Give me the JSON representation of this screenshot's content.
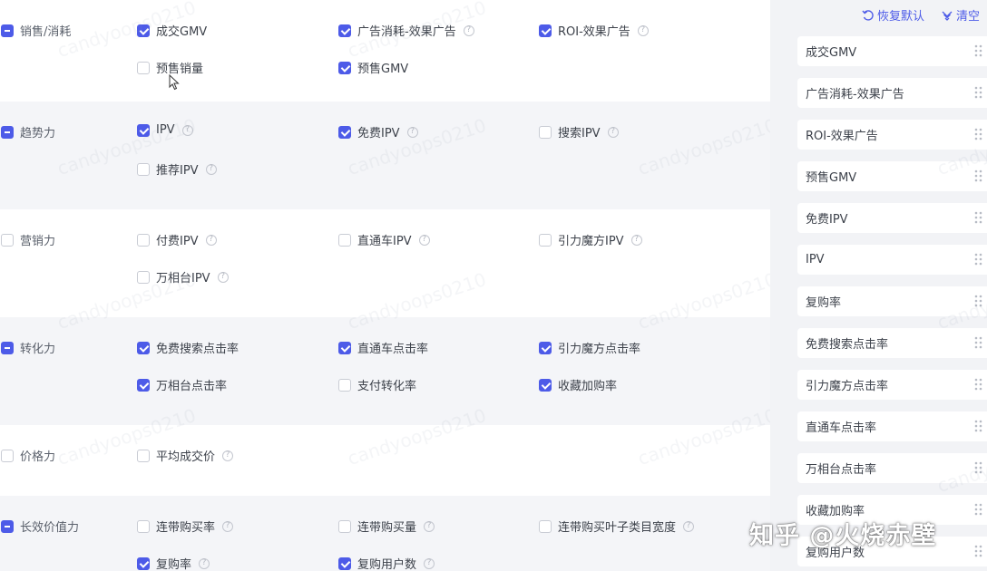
{
  "groups": [
    {
      "label": "销售/消耗",
      "state": "mixed",
      "items": [
        {
          "label": "成交GMV",
          "checked": true,
          "help": false
        },
        {
          "label": "广告消耗-效果广告",
          "checked": true,
          "help": true
        },
        {
          "label": "ROI-效果广告",
          "checked": true,
          "help": true
        },
        {
          "label": "预售销量",
          "checked": false,
          "help": false
        },
        {
          "label": "预售GMV",
          "checked": true,
          "help": false
        }
      ]
    },
    {
      "label": "趋势力",
      "state": "mixed",
      "items": [
        {
          "label": "IPV",
          "checked": true,
          "help": true
        },
        {
          "label": "免费IPV",
          "checked": true,
          "help": true
        },
        {
          "label": "搜索IPV",
          "checked": false,
          "help": true
        },
        {
          "label": "推荐IPV",
          "checked": false,
          "help": true
        }
      ]
    },
    {
      "label": "营销力",
      "state": "unchecked",
      "items": [
        {
          "label": "付费IPV",
          "checked": false,
          "help": true
        },
        {
          "label": "直通车IPV",
          "checked": false,
          "help": true
        },
        {
          "label": "引力魔方IPV",
          "checked": false,
          "help": true
        },
        {
          "label": "万相台IPV",
          "checked": false,
          "help": true
        }
      ]
    },
    {
      "label": "转化力",
      "state": "mixed",
      "items": [
        {
          "label": "免费搜索点击率",
          "checked": true,
          "help": false
        },
        {
          "label": "直通车点击率",
          "checked": true,
          "help": false
        },
        {
          "label": "引力魔方点击率",
          "checked": true,
          "help": false
        },
        {
          "label": "万相台点击率",
          "checked": true,
          "help": false
        },
        {
          "label": "支付转化率",
          "checked": false,
          "help": false
        },
        {
          "label": "收藏加购率",
          "checked": true,
          "help": false
        }
      ]
    },
    {
      "label": "价格力",
      "state": "unchecked",
      "items": [
        {
          "label": "平均成交价",
          "checked": false,
          "help": true
        }
      ]
    },
    {
      "label": "长效价值力",
      "state": "mixed",
      "items": [
        {
          "label": "连带购买率",
          "checked": false,
          "help": true
        },
        {
          "label": "连带购买量",
          "checked": false,
          "help": true
        },
        {
          "label": "连带购买叶子类目宽度",
          "checked": false,
          "help": true
        },
        {
          "label": "复购率",
          "checked": true,
          "help": true
        },
        {
          "label": "复购用户数",
          "checked": true,
          "help": true
        }
      ]
    }
  ],
  "panel": {
    "restore_label": "恢复默认",
    "clear_label": "清空",
    "selected": [
      "成交GMV",
      "广告消耗-效果广告",
      "ROI-效果广告",
      "预售GMV",
      "免费IPV",
      "IPV",
      "复购率",
      "免费搜索点击率",
      "引力魔方点击率",
      "直通车点击率",
      "万相台点击率",
      "收藏加购率",
      "复购用户数"
    ]
  },
  "watermark_text": "candyoops0210",
  "overlay_text": "知乎 @火烧赤壁",
  "colors": {
    "accent": "#4d5be8",
    "shade": "#f4f5f8",
    "panel_bg": "#f2f3f6"
  },
  "icons": {
    "help": "question-circle-icon",
    "restore": "undo-icon",
    "clear": "brush-icon",
    "drag": "drag-handle-icon",
    "cursor": "mouse-pointer-icon"
  }
}
